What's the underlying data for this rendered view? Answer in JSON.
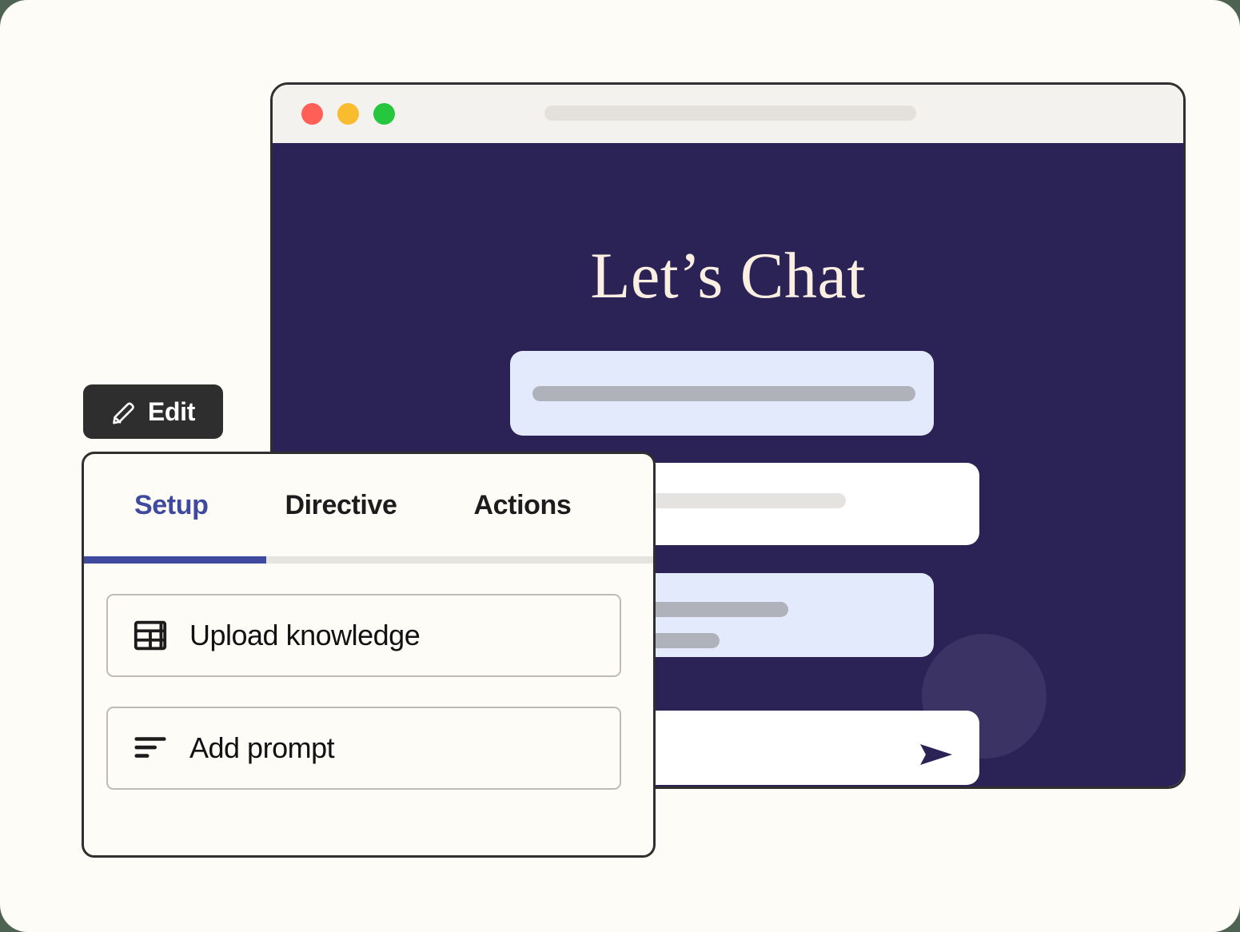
{
  "browser": {
    "traffic_lights": [
      {
        "name": "close",
        "color": "#FF5F57"
      },
      {
        "name": "minimize",
        "color": "#F9BC2E"
      },
      {
        "name": "maximize",
        "color": "#27C63F"
      }
    ],
    "address_bar_value": "",
    "address_bar_placeholder": ""
  },
  "chat": {
    "title": "Let’s Chat",
    "background_color": "#2B2256",
    "title_color": "#FAEFE1",
    "bubbles": [
      {
        "id": "bubble-1",
        "side": "incoming",
        "color": "#E2EAFB",
        "lines": 1
      },
      {
        "id": "bubble-2",
        "side": "outgoing",
        "color": "#FFFFFF",
        "lines": 1
      },
      {
        "id": "bubble-3",
        "side": "incoming",
        "color": "#E2EAFB",
        "lines": 2
      },
      {
        "id": "bubble-4",
        "side": "composer",
        "color": "#FFFFFF",
        "lines": 0
      }
    ],
    "composer": {
      "value": "",
      "placeholder": "",
      "send_icon": "send-icon",
      "send_icon_color": "#2B2256"
    }
  },
  "edit_button": {
    "label": "Edit",
    "icon": "pencil-icon",
    "background_color": "#2E2E2E",
    "text_color": "#FFFFFF"
  },
  "settings_card": {
    "tabs": [
      {
        "label": "Setup",
        "active": true
      },
      {
        "label": "Directive",
        "active": false
      },
      {
        "label": "Actions",
        "active": false
      }
    ],
    "active_tab_color": "#3F4A9E",
    "options": [
      {
        "label": "Upload knowledge",
        "icon": "table-icon"
      },
      {
        "label": "Add prompt",
        "icon": "text-lines-icon"
      }
    ]
  }
}
